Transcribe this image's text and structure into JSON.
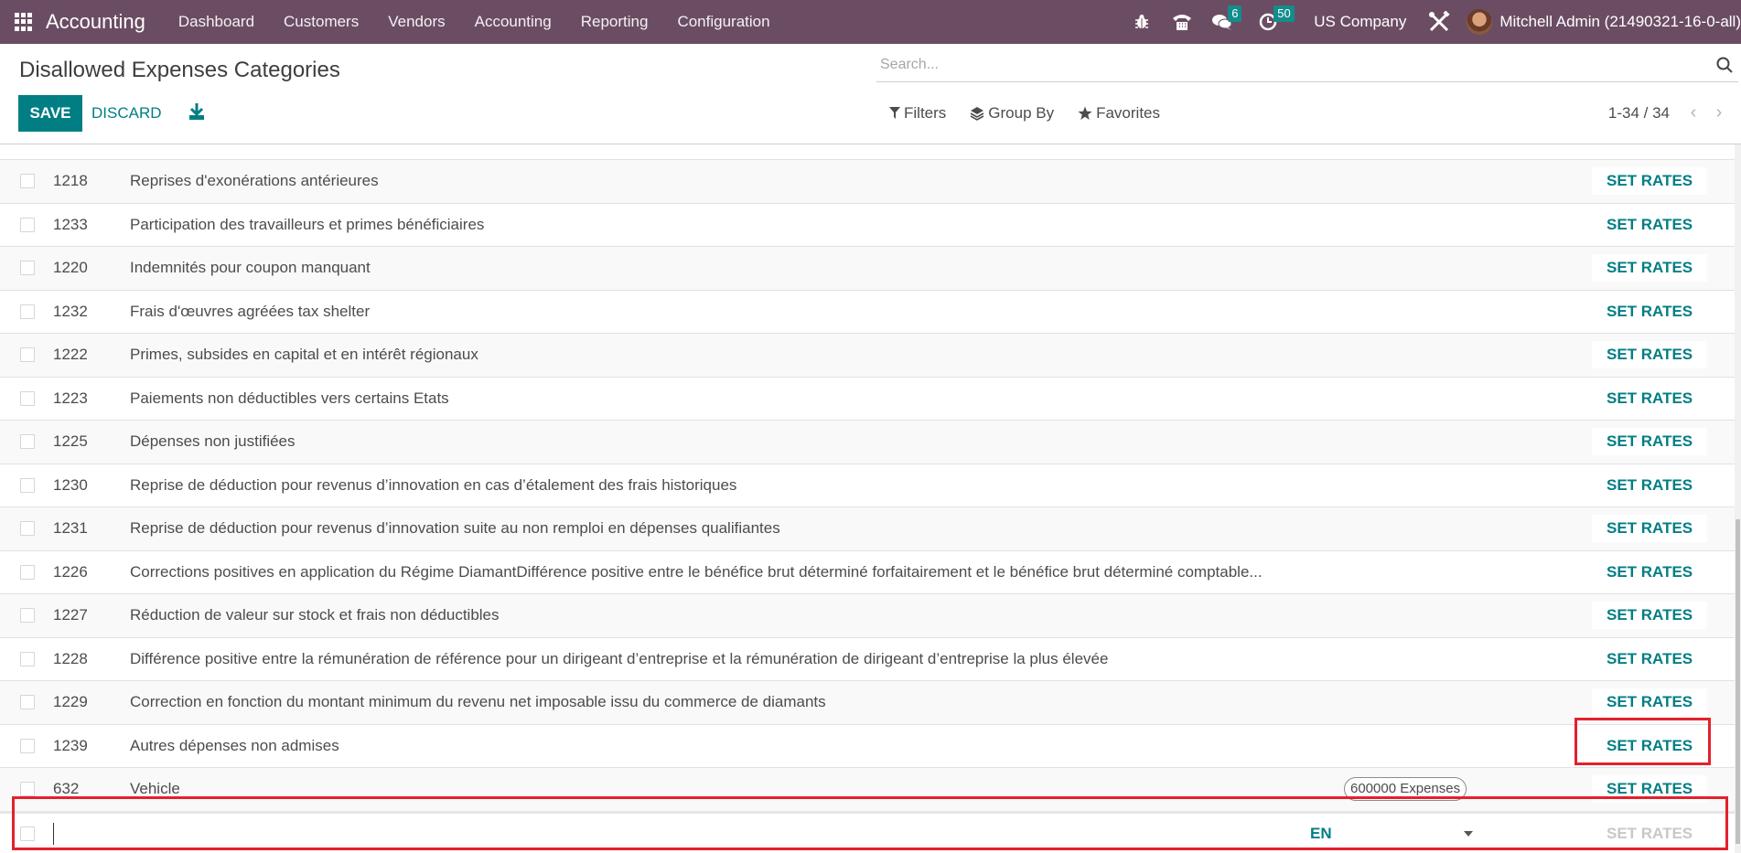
{
  "navbar": {
    "app_name": "Accounting",
    "menu": [
      "Dashboard",
      "Customers",
      "Vendors",
      "Accounting",
      "Reporting",
      "Configuration"
    ],
    "messages_count": "6",
    "activities_count": "50",
    "company": "US Company",
    "user": "Mitchell Admin (21490321-16-0-all)"
  },
  "control_panel": {
    "title": "Disallowed Expenses Categories",
    "save_label": "SAVE",
    "discard_label": "DISCARD",
    "search_placeholder": "Search...",
    "filters_label": "Filters",
    "groupby_label": "Group By",
    "favorites_label": "Favorites",
    "pager": "1-34 / 34"
  },
  "list": {
    "action_label": "SET RATES",
    "rows": [
      {
        "code": "1218",
        "name": "Reprises d'exonérations antérieures",
        "tag": ""
      },
      {
        "code": "1233",
        "name": "Participation des travailleurs et primes bénéficiaires",
        "tag": ""
      },
      {
        "code": "1220",
        "name": "Indemnités pour coupon manquant",
        "tag": ""
      },
      {
        "code": "1232",
        "name": "Frais d'œuvres agréées tax shelter",
        "tag": ""
      },
      {
        "code": "1222",
        "name": "Primes, subsides en capital et en intérêt régionaux",
        "tag": ""
      },
      {
        "code": "1223",
        "name": "Paiements non déductibles vers certains Etats",
        "tag": ""
      },
      {
        "code": "1225",
        "name": "Dépenses non justifiées",
        "tag": ""
      },
      {
        "code": "1230",
        "name": "Reprise de déduction pour revenus d’innovation en cas d’étalement des frais historiques",
        "tag": ""
      },
      {
        "code": "1231",
        "name": "Reprise de déduction pour revenus d’innovation suite au non remploi en dépenses qualifiantes",
        "tag": ""
      },
      {
        "code": "1226",
        "name": "Corrections positives en application du Régime DiamantDifférence positive entre le bénéfice brut déterminé forfaitairement et le bénéfice brut déterminé comptable...",
        "tag": ""
      },
      {
        "code": "1227",
        "name": "Réduction de valeur sur stock et frais non déductibles",
        "tag": ""
      },
      {
        "code": "1228",
        "name": "Différence positive entre la rémunération de référence pour un dirigeant d’entreprise et la rémunération de dirigeant d’entreprise la plus élevée",
        "tag": ""
      },
      {
        "code": "1229",
        "name": "Correction en fonction du montant minimum du revenu net imposable issu du commerce de diamants",
        "tag": ""
      },
      {
        "code": "1239",
        "name": "Autres dépenses non admises",
        "tag": ""
      },
      {
        "code": "632",
        "name": "Vehicle",
        "tag": "600000 Expenses"
      }
    ],
    "new_row": {
      "code": "",
      "language": "EN",
      "action_label": "SET RATES"
    }
  },
  "colors": {
    "navbar": "#6b4d63",
    "primary": "#017e84",
    "badge": "#138c8c",
    "highlight": "#e3212b"
  }
}
